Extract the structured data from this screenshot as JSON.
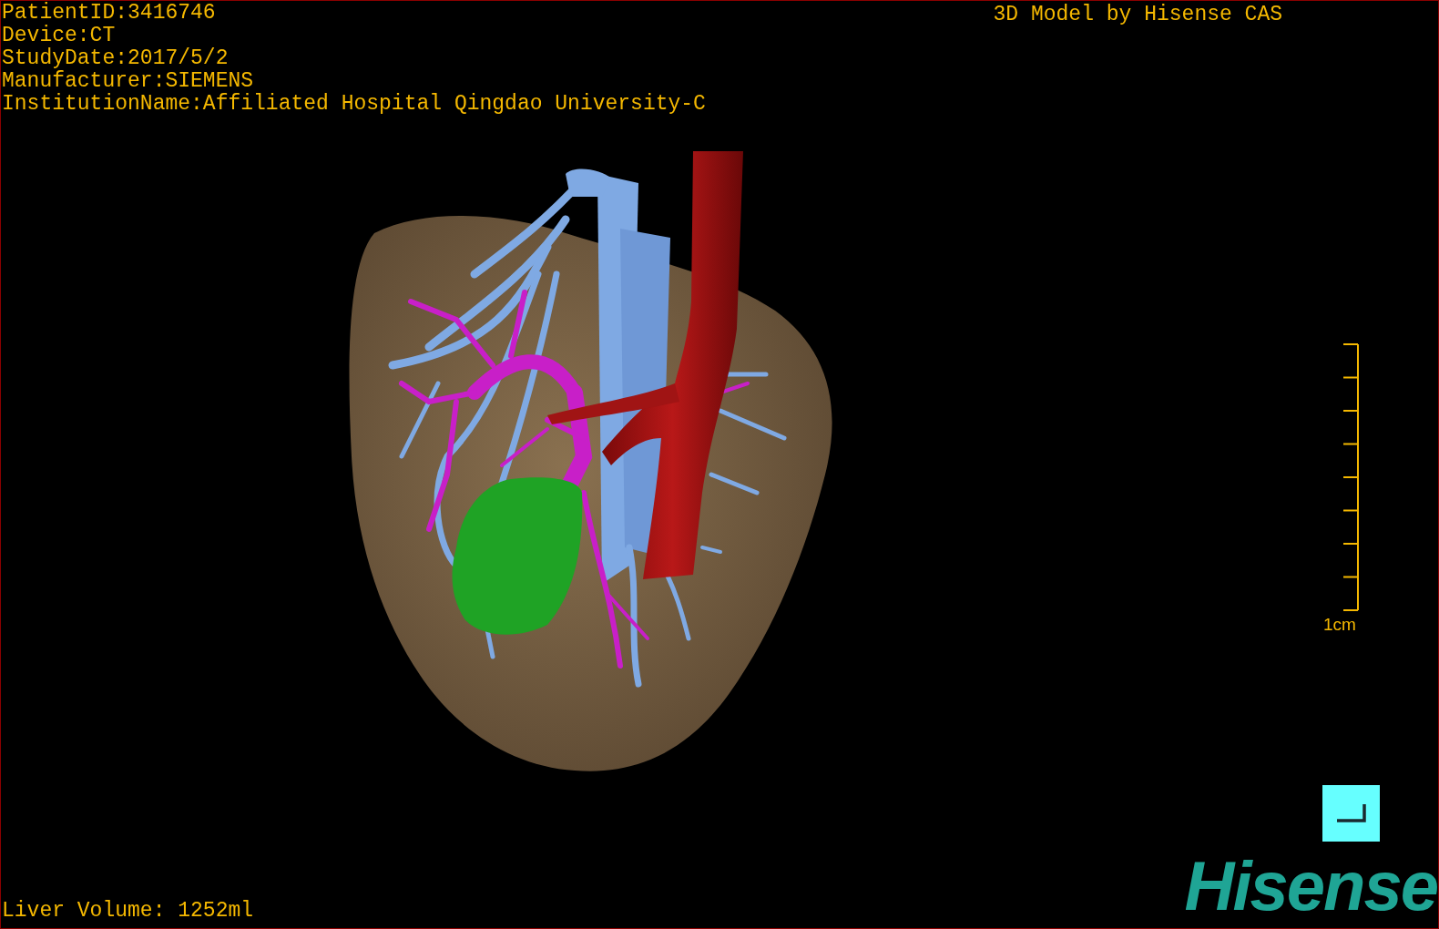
{
  "info_lines": [
    "PatientID:3416746",
    "Device:CT",
    "StudyDate:2017/5/2",
    "Manufacturer:SIEMENS",
    "InstitutionName:Affiliated Hospital Qingdao University-C"
  ],
  "title": "3D Model by Hisense CAS",
  "scale_bar": {
    "label": "1cm"
  },
  "volume": "Liver Volume: 1252ml",
  "logo": "Hisense"
}
